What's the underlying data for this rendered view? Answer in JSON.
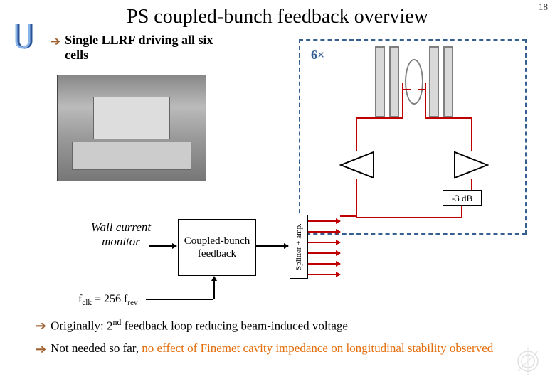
{
  "page_number": "18",
  "title": "PS coupled-bunch feedback overview",
  "bullet_top": "Single LLRF driving all six cells",
  "diagram": {
    "multiplier": "6×",
    "attenuator": "-3 dB",
    "splitter_label": "Splitter + amp."
  },
  "wcm_label": "Wall current monitor",
  "fb_block": "Coupled-bunch feedback",
  "fclk_prefix": "f",
  "fclk_sub1": "clk",
  "fclk_eq": " = 256 ",
  "fclk_prefix2": "f",
  "fclk_sub2": "rev",
  "bottom": {
    "line1_pre": "Originally: 2",
    "line1_sup": "nd",
    "line1_post": " feedback loop reducing beam-induced voltage",
    "line2_pre": "Not needed so far, ",
    "line2_orange": "no effect of Finemet cavity impedance on longitudinal stability observed"
  }
}
